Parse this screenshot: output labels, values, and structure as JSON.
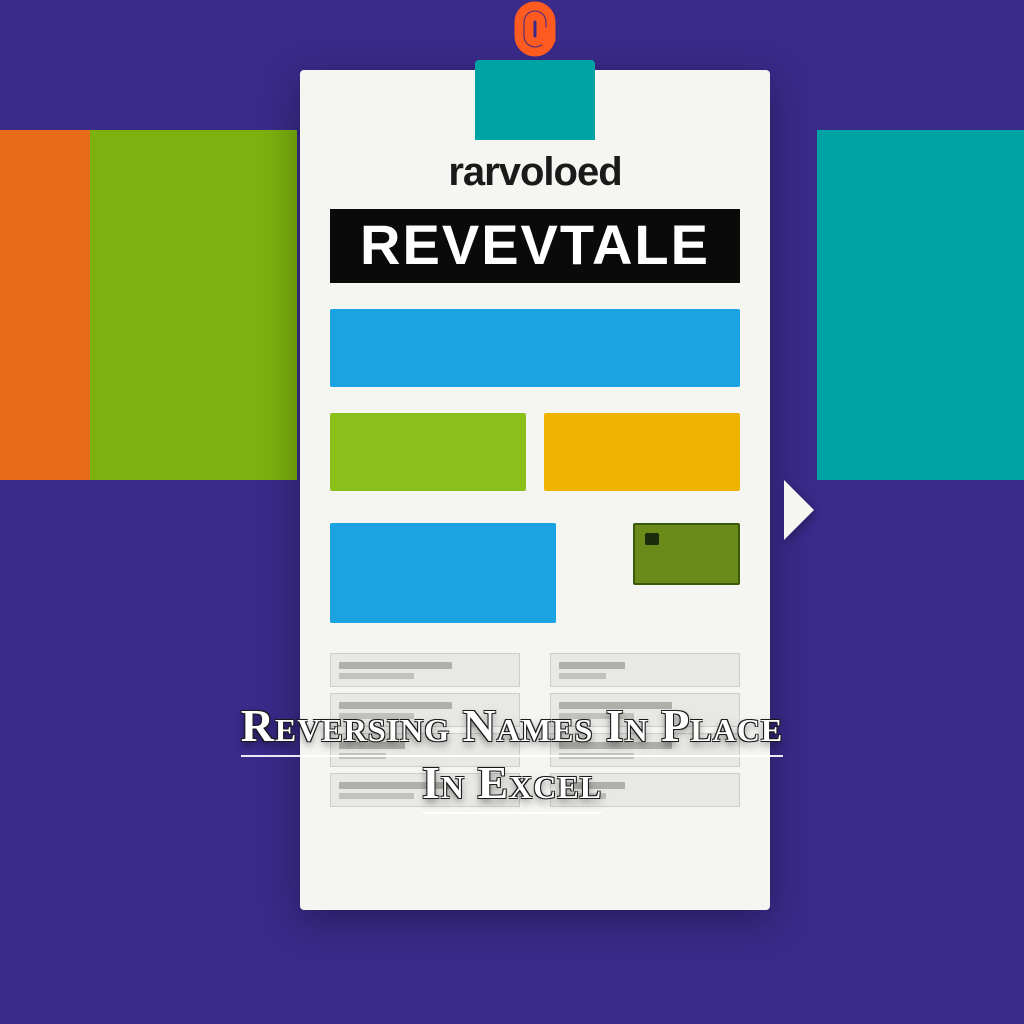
{
  "colors": {
    "background": "#3a2a8a",
    "band_orange": "#e86b1a",
    "band_green": "#7cb10f",
    "band_teal": "#00a3a3",
    "clip_orange": "#ff5a1f",
    "blue": "#1aa3e0",
    "green": "#8bbf1a",
    "yellow": "#f0b400",
    "olive": "#6a8a1a"
  },
  "card": {
    "small_title": "rarvoloed",
    "banner": "REVEVTALE"
  },
  "caption": {
    "line1": "Reversing Names In Place",
    "line2": "In Excel"
  }
}
